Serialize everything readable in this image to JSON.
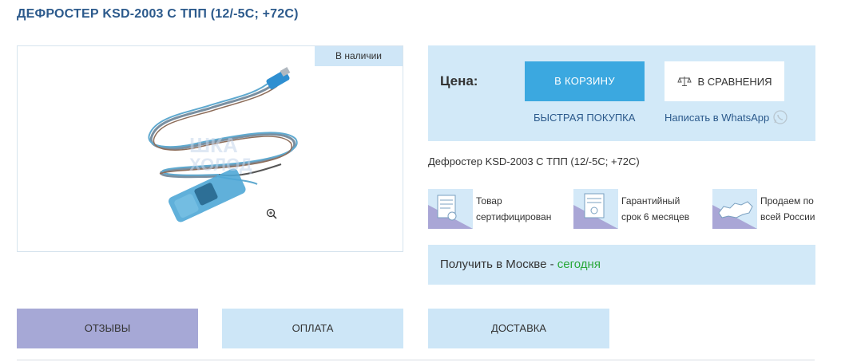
{
  "product": {
    "title": "ДЕФРОСТЕР KSD-2003 С ТПП (12/-5С; +72С)",
    "stock_badge": "В наличии",
    "description": "Дефростер KSD-2003 С ТПП (12/-5С; +72С)"
  },
  "watermark": {
    "line1": "ШКА",
    "line2": "ХОЛОД"
  },
  "price_box": {
    "price_label": "Цена:",
    "cart_button": "В КОРЗИНУ",
    "compare_button": "В СРАВНЕНИЯ",
    "quick_buy": "БЫСТРАЯ ПОКУПКА",
    "whatsapp": "Написать в WhatsApp"
  },
  "features": [
    {
      "icon": "certificate-icon",
      "line1": "Товар",
      "line2": "сертифицирован"
    },
    {
      "icon": "warranty-icon",
      "line1": "Гарантийный",
      "line2": "срок 6 месяцев"
    },
    {
      "icon": "russia-map-icon",
      "line1": "Продаем по",
      "line2": "всей России"
    }
  ],
  "delivery_note": {
    "prefix": "Получить в Москве - ",
    "highlight": "сегодня"
  },
  "tabs": {
    "reviews": "ОТЗЫВЫ",
    "payment": "ОПЛАТА",
    "delivery": "ДОСТАВКА"
  },
  "colors": {
    "accent": "#3ba8e0",
    "panel": "#d2e9f8",
    "title": "#2c5a8c",
    "today": "#2aa83a",
    "tab_active": "#a6a8d6"
  }
}
